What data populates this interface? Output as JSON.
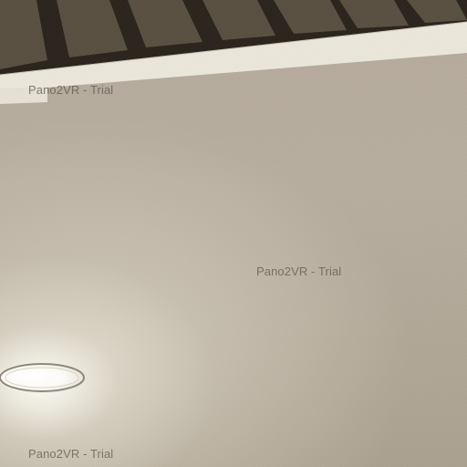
{
  "scene": {
    "description_colors": {
      "wall": "#b7ad9f",
      "trim": "#ece7dc",
      "beam": "#4a4236",
      "light": "#ffffff"
    }
  },
  "watermarks": [
    {
      "text": "Pano2VR - Trial"
    },
    {
      "text": "Pano2VR - Trial"
    },
    {
      "text": "Pano2VR - Trial"
    }
  ]
}
